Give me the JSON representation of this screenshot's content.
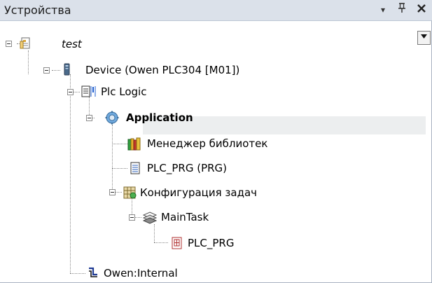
{
  "panel": {
    "title": "Устройства",
    "buttons": {
      "dropdown": "▾",
      "pin": "ꟼ",
      "close": "✕"
    }
  },
  "combo": {
    "arrow": "▾"
  },
  "tree": {
    "items": [
      {
        "label": "test",
        "icon": "project-file-icon"
      },
      {
        "label": "Device (Owen PLC304 [M01])",
        "icon": "device-icon"
      },
      {
        "label": "Plc Logic",
        "icon": "plc-logic-icon"
      },
      {
        "label": "Application",
        "icon": "application-gear-icon"
      },
      {
        "label": "Менеджер библиотек",
        "icon": "library-books-icon"
      },
      {
        "label": "PLC_PRG (PRG)",
        "icon": "pou-document-icon"
      },
      {
        "label": "Конфигурация задач",
        "icon": "task-config-icon"
      },
      {
        "label": "MainTask",
        "icon": "task-stack-icon"
      },
      {
        "label": "PLC_PRG",
        "icon": "program-call-icon"
      },
      {
        "label": "Owen:Internal",
        "icon": "connector-icon"
      }
    ]
  },
  "colors": {
    "titlebar_bg": "#dbe1ea",
    "selection_bg": "#eceeef",
    "border": "#a9b3c2"
  }
}
